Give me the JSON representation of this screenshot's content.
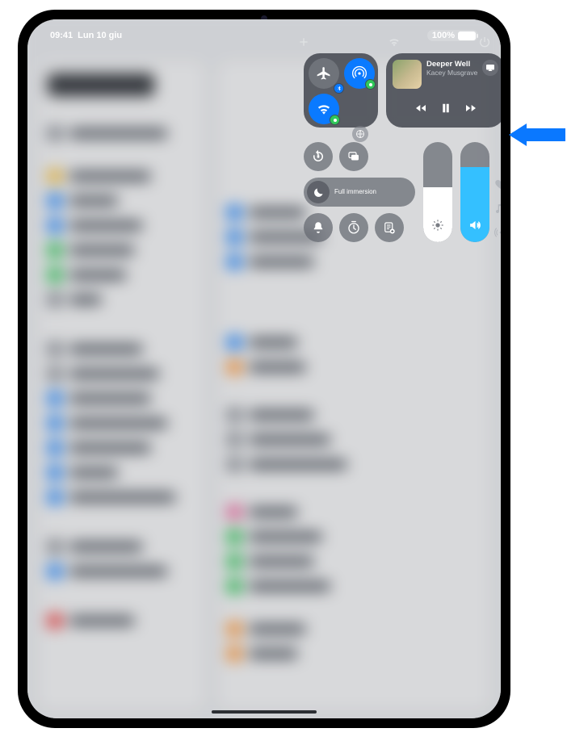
{
  "status": {
    "time": "09:41",
    "date": "Lun 10 giu",
    "battery_pct": "100%"
  },
  "control_center": {
    "connectivity": {
      "airplane_active": false,
      "airdrop_active": true,
      "wifi_active": true,
      "bluetooth_indicator": true,
      "cellular_indicator": true
    },
    "media": {
      "title": "Deeper Well",
      "artist": "Kacey Musgrave",
      "playing": true
    },
    "focus": {
      "label": "Full immersion"
    },
    "brightness_pct": 55,
    "volume_pct": 75
  },
  "bg_settings_title": "Settings"
}
